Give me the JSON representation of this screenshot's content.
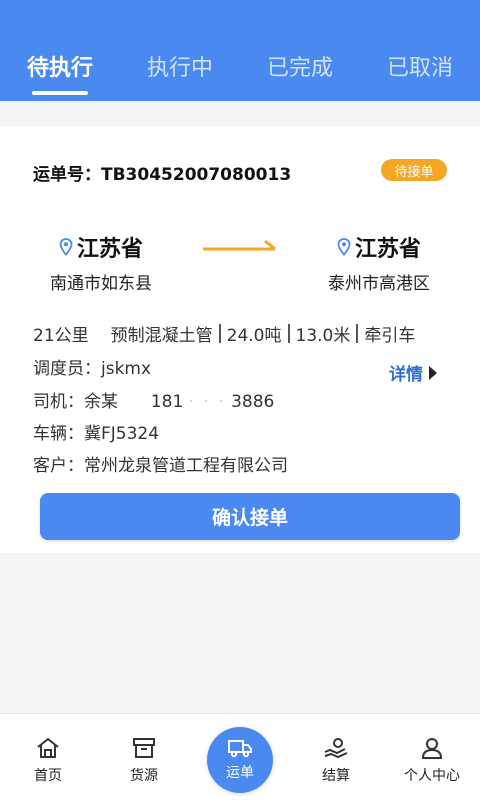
{
  "tabs": [
    {
      "label": "待执行",
      "active": true
    },
    {
      "label": "执行中",
      "active": false
    },
    {
      "label": "已完成",
      "active": false
    },
    {
      "label": "已取消",
      "active": false
    }
  ],
  "order": {
    "number_label": "运单号：",
    "number": "TB30452007080013",
    "status": "待接单",
    "origin": {
      "province": "江苏省",
      "city": "南通市如东县"
    },
    "destination": {
      "province": "江苏省",
      "city": "泰州市高港区"
    },
    "distance": "21公里",
    "cargo": "预制混凝土管",
    "weight": "24.0吨",
    "length": "13.0米",
    "vehicle_type": "牵引车",
    "dispatcher": "调度员：jskmx",
    "driver_label": "司机：余某",
    "driver_phone_start": "181",
    "driver_phone_mask": "·  ·  ·",
    "driver_phone_end": "3886",
    "vehicle": "车辆：冀FJ5324",
    "customer": "客户：常州龙泉管道工程有限公司",
    "detail_label": "详情",
    "confirm_label": "确认接单"
  },
  "nav": [
    {
      "label": "首页",
      "icon": "home-icon"
    },
    {
      "label": "货源",
      "icon": "box-icon"
    },
    {
      "label": "运单",
      "icon": "truck-icon"
    },
    {
      "label": "结算",
      "icon": "settlement-icon"
    },
    {
      "label": "个人中心",
      "icon": "person-icon"
    }
  ],
  "colors": {
    "primary": "#4a8af0",
    "badge": "#f5a623",
    "arrow": "#f5a623",
    "link": "#2f6fd8"
  }
}
